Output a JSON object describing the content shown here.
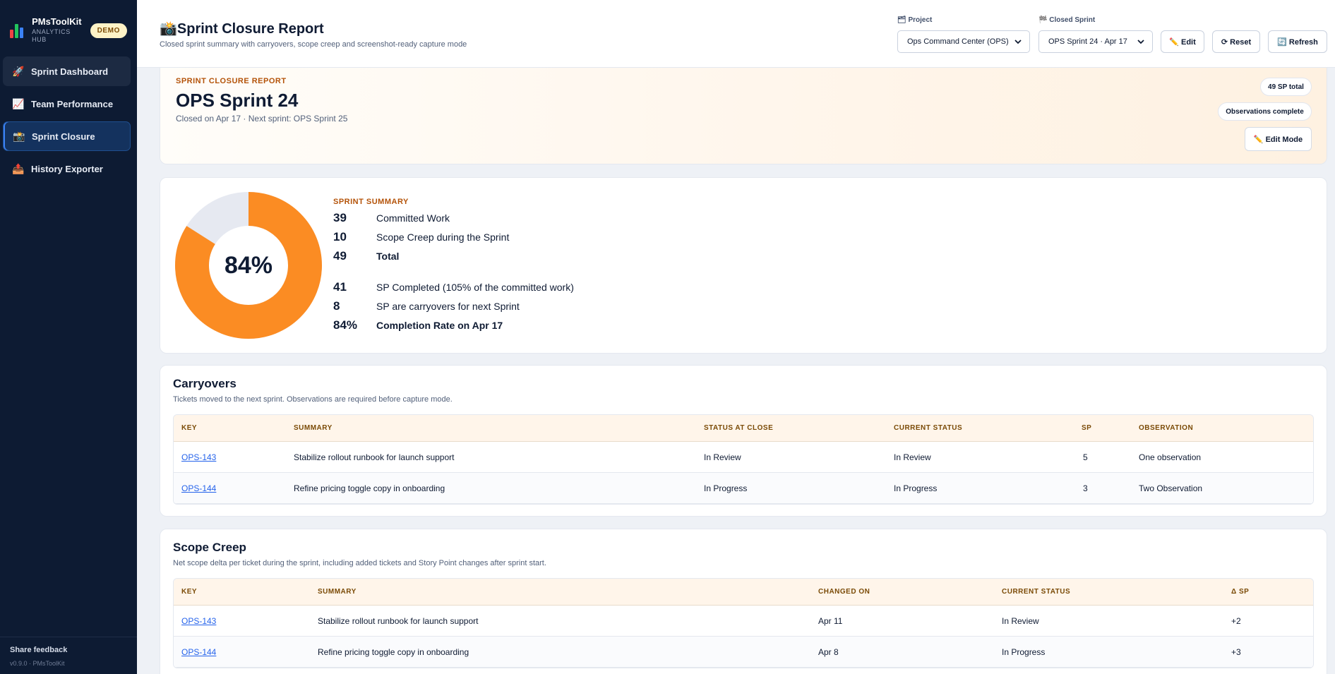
{
  "sidebar": {
    "brand_name": "PMsToolKit",
    "brand_sub": "ANALYTICS HUB",
    "demo": "DEMO",
    "items": [
      {
        "icon": "🚀",
        "label": "Sprint Dashboard"
      },
      {
        "icon": "📈",
        "label": "Team Performance"
      },
      {
        "icon": "📸",
        "label": "Sprint Closure"
      },
      {
        "icon": "📤",
        "label": "History Exporter"
      }
    ],
    "feedback": "Share feedback",
    "version": "v0.9.0 · PMsToolKit"
  },
  "header": {
    "title_icon": "📸",
    "title": "Sprint Closure Report",
    "subtitle": "Closed sprint summary with carryovers, scope creep and screenshot-ready capture mode",
    "project_label": "🗂 Project",
    "project_value": "Ops Command Center (OPS)",
    "sprint_label": "🏁 Closed Sprint",
    "sprint_value": "OPS Sprint 24 · Apr 17",
    "edit": "✏️ Edit",
    "reset": "⟳ Reset",
    "refresh": "🔄 Refresh"
  },
  "hero": {
    "eyebrow": "SPRINT CLOSURE REPORT",
    "title": "OPS Sprint 24",
    "subtitle": "Closed on Apr 17 · Next sprint: OPS Sprint 25",
    "pill_total": "49 SP total",
    "pill_obs": "Observations complete",
    "edit_mode": "✏️ Edit Mode"
  },
  "summary": {
    "percent_label": "84%",
    "completion_fraction": 0.84,
    "colors": {
      "done": "#fb8c23",
      "remaining": "#e6e9f1"
    },
    "eyebrow": "SPRINT SUMMARY",
    "rows": [
      {
        "num": "39",
        "text": "Committed Work"
      },
      {
        "num": "10",
        "text": "Scope Creep during the Sprint"
      },
      {
        "num": "49",
        "text": "Total"
      },
      {
        "num": "41",
        "text": "SP Completed (105% of the committed work)"
      },
      {
        "num": "8",
        "text": "SP are carryovers for next Sprint"
      },
      {
        "num": "84%",
        "text": "Completion Rate on Apr 17"
      }
    ]
  },
  "carryovers": {
    "title": "Carryovers",
    "subtitle": "Tickets moved to the next sprint. Observations are required before capture mode.",
    "columns": [
      "KEY",
      "SUMMARY",
      "STATUS AT CLOSE",
      "CURRENT STATUS",
      "SP",
      "OBSERVATION"
    ],
    "rows": [
      [
        "OPS-143",
        "Stabilize rollout runbook for launch support",
        "In Review",
        "In Review",
        "5",
        "One observation"
      ],
      [
        "OPS-144",
        "Refine pricing toggle copy in onboarding",
        "In Progress",
        "In Progress",
        "3",
        "Two Observation"
      ]
    ]
  },
  "scope_creep": {
    "title": "Scope Creep",
    "subtitle": "Net scope delta per ticket during the sprint, including added tickets and Story Point changes after sprint start.",
    "columns": [
      "KEY",
      "SUMMARY",
      "CHANGED ON",
      "CURRENT STATUS",
      "Δ SP"
    ],
    "rows": [
      [
        "OPS-143",
        "Stabilize rollout runbook for launch support",
        "Apr 11",
        "In Review",
        "+2"
      ],
      [
        "OPS-144",
        "Refine pricing toggle copy in onboarding",
        "Apr 8",
        "In Progress",
        "+3"
      ]
    ]
  }
}
